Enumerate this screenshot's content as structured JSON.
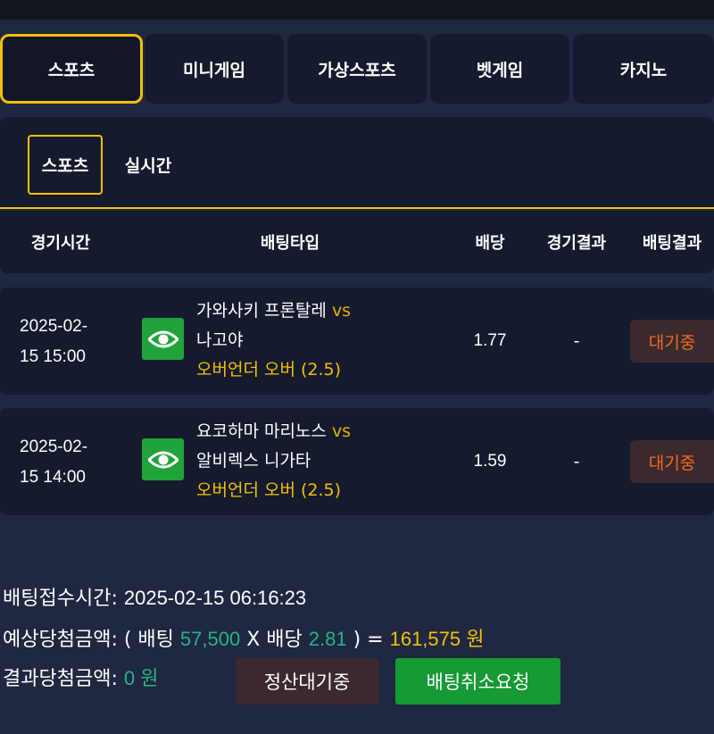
{
  "tabs": [
    "스포츠",
    "미니게임",
    "가상스포츠",
    "벳게임",
    "카지노"
  ],
  "subtabs": [
    "스포츠",
    "실시간"
  ],
  "table": {
    "headers": [
      "경기시간",
      "배팅타입",
      "배당",
      "경기결과",
      "배팅결과"
    ],
    "rows": [
      {
        "date": "2025-02-",
        "time": "15 15:00",
        "team1": "가와사키 프론탈레",
        "vs": "vs",
        "team2": "나고야",
        "bet_type": "오버언더 오버 (2.5)",
        "odds": "1.77",
        "game_result": "-",
        "bet_result": "대기중"
      },
      {
        "date": "2025-02-",
        "time": "15 14:00",
        "team1": "요코하마 마리노스",
        "vs": "vs",
        "team2": "알비렉스 니가타",
        "bet_type": "오버언더 오버 (2.5)",
        "odds": "1.59",
        "game_result": "-",
        "bet_result": "대기중"
      }
    ]
  },
  "summary": {
    "accept_label": "배팅접수시간:",
    "accept_time": "2025-02-15 06:16:23",
    "expected_label": "예상당첨금액: ( 배팅",
    "bet_amount": "57,500",
    "x_label": "X 배당",
    "odds_total": "2.81",
    "eq_label": ") =",
    "expected_amount": "161,575 원",
    "result_label": "결과당첨금액:",
    "result_amount": "0 원"
  },
  "buttons": {
    "settle_wait": "정산대기중",
    "cancel_request": "배팅취소요청"
  },
  "colors": {
    "background": "#202740",
    "panel": "#151a2e",
    "accent": "#f2c200",
    "green": "#23b585",
    "status_text": "#f06a23"
  }
}
